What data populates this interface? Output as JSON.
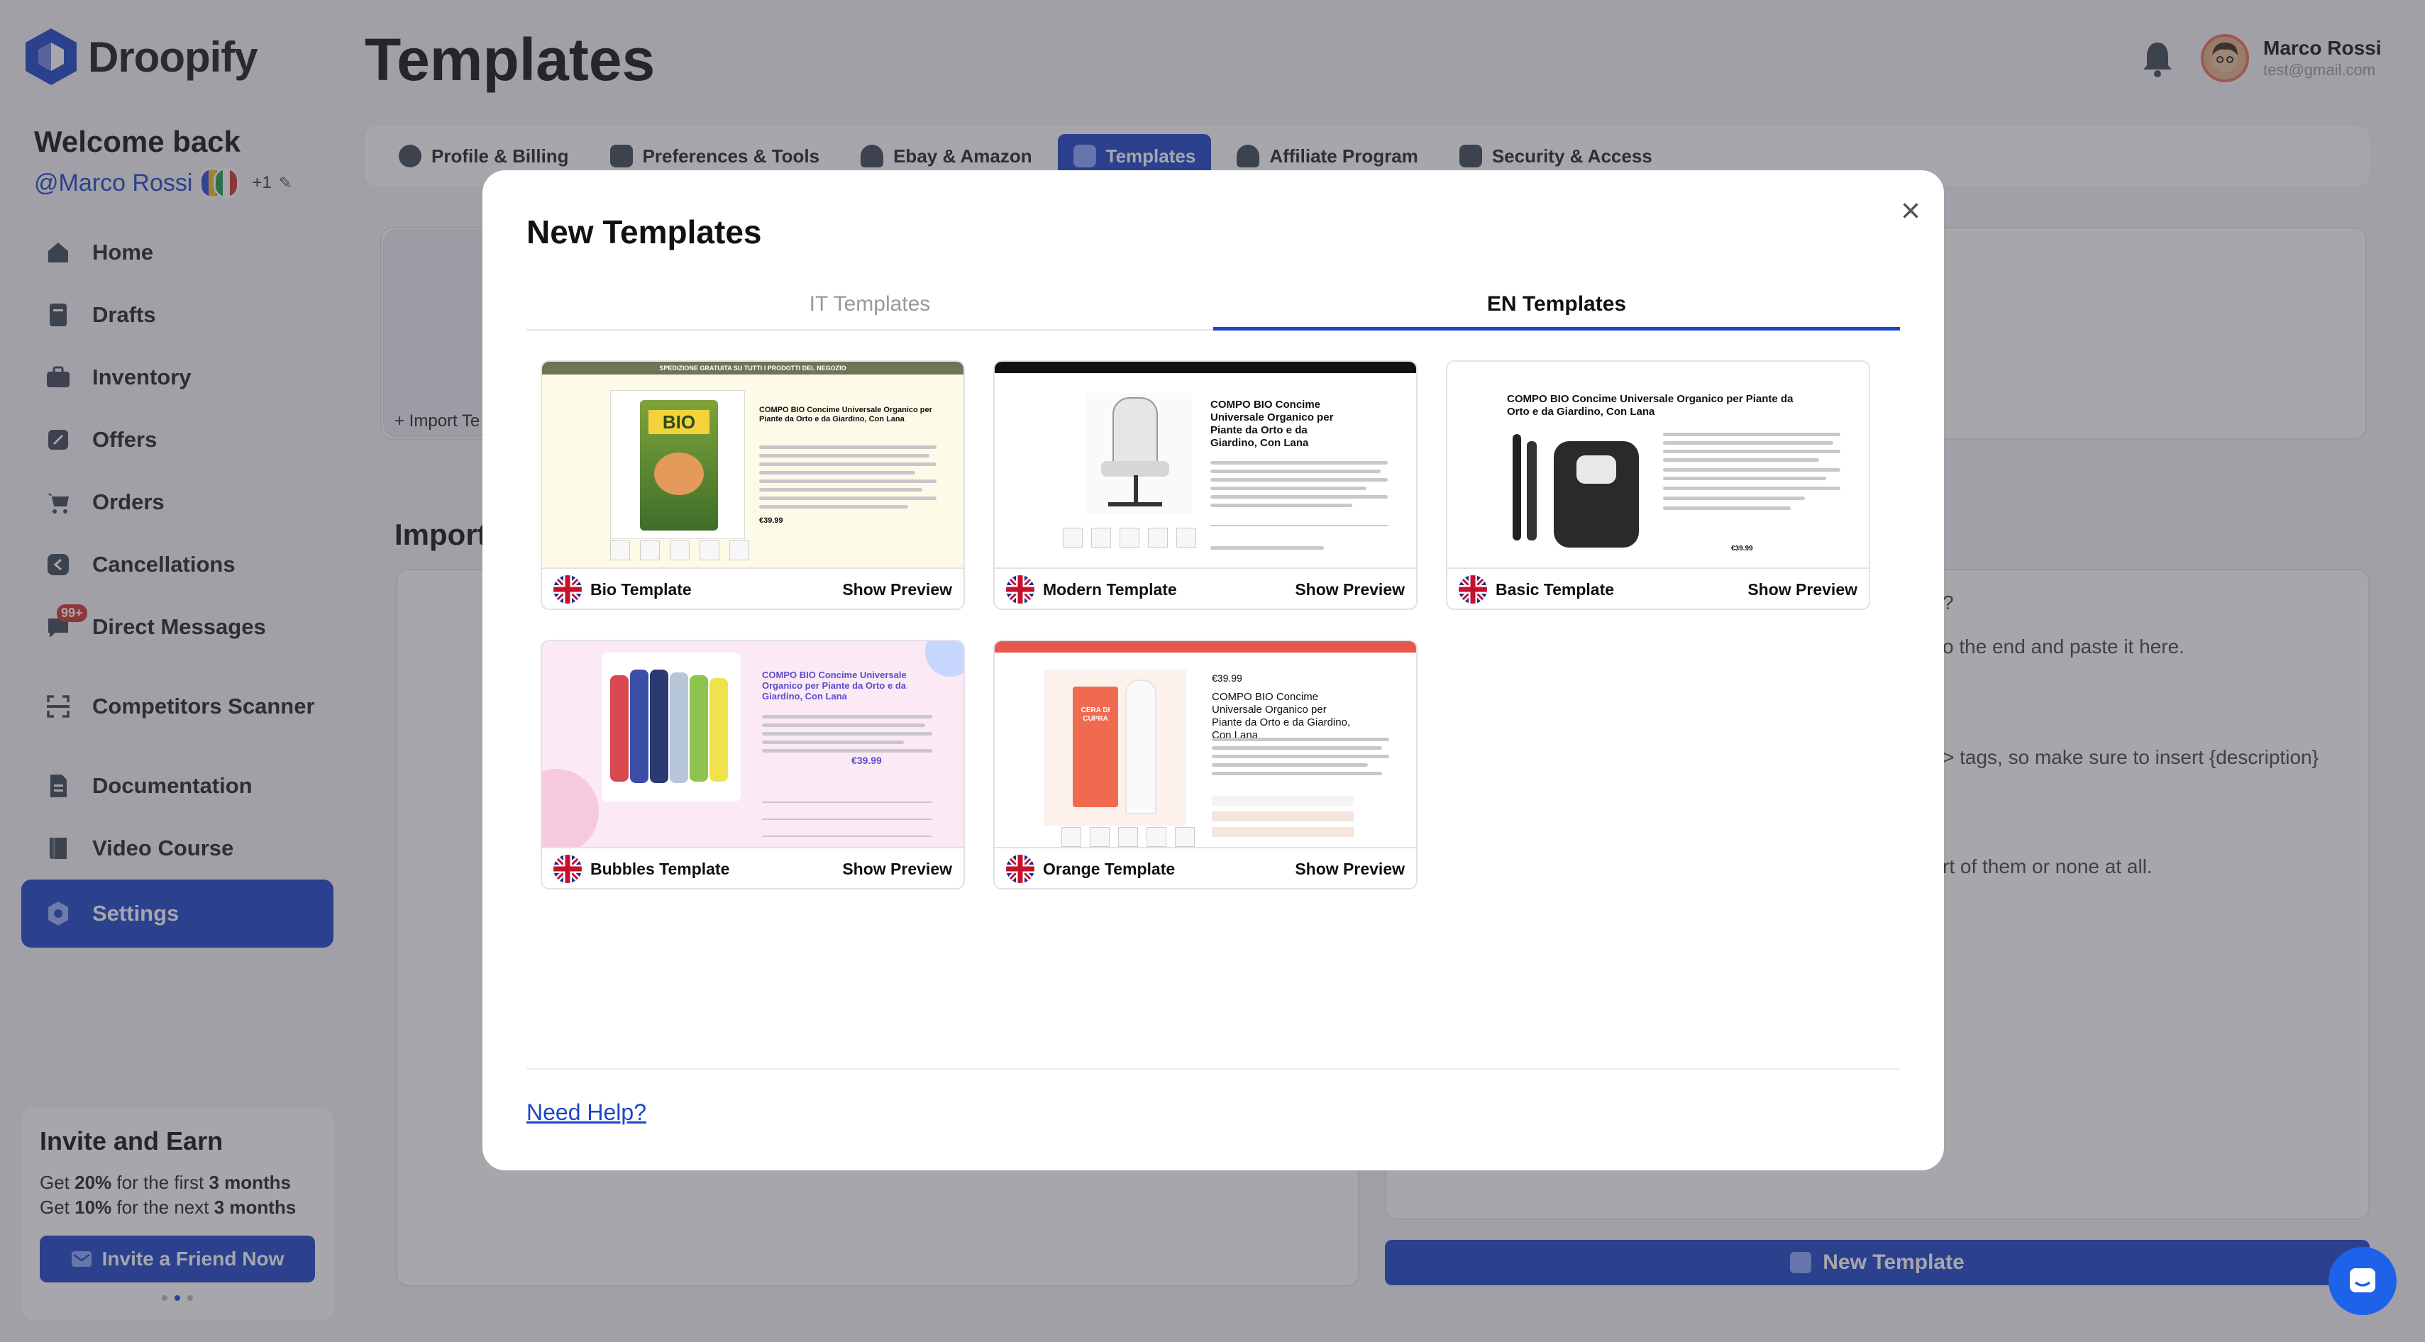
{
  "app": {
    "name": "Droopify",
    "page_title": "Templates"
  },
  "user": {
    "name": "Marco Rossi",
    "email": "test@gmail.com",
    "handle": "@Marco Rossi",
    "extra_accounts": "+1"
  },
  "welcome": {
    "title": "Welcome back"
  },
  "nav": {
    "items": [
      {
        "label": "Home",
        "icon": "home-icon"
      },
      {
        "label": "Drafts",
        "icon": "drafts-icon"
      },
      {
        "label": "Inventory",
        "icon": "inventory-icon"
      },
      {
        "label": "Offers",
        "icon": "offers-icon"
      },
      {
        "label": "Orders",
        "icon": "cart-icon"
      },
      {
        "label": "Cancellations",
        "icon": "cancel-icon"
      },
      {
        "label": "Direct Messages",
        "icon": "messages-icon",
        "badge": "99+"
      },
      {
        "label": "Competitors Scanner",
        "icon": "scanner-icon"
      },
      {
        "label": "Documentation",
        "icon": "document-icon"
      },
      {
        "label": "Video Course",
        "icon": "book-icon"
      },
      {
        "label": "Settings",
        "icon": "gear-icon",
        "active": true
      }
    ]
  },
  "invite": {
    "title": "Invite and Earn",
    "line1_pre": "Get ",
    "line1_pct": "20%",
    "line1_mid": " for the first ",
    "line1_dur": "3 months",
    "line2_pre": "Get ",
    "line2_pct": "10%",
    "line2_mid": " for the next ",
    "line2_dur": "3 months",
    "button": "Invite a Friend Now"
  },
  "settings_tabs": [
    {
      "label": "Profile & Billing"
    },
    {
      "label": "Preferences & Tools"
    },
    {
      "label": "Ebay & Amazon"
    },
    {
      "label": "Templates",
      "active": true
    },
    {
      "label": "Affiliate Program"
    },
    {
      "label": "Security & Access"
    }
  ],
  "background": {
    "import_link": "+ Import Te",
    "import_heading": "Import",
    "hint_q": "?",
    "hint1": "o the end and paste it here.",
    "hint2": "> tags, so make sure to insert {description}",
    "hint3": "rt of them or none at all.",
    "new_template_button": "New Template"
  },
  "modal": {
    "title": "New Templates",
    "tabs": [
      {
        "label": "IT Templates"
      },
      {
        "label": "EN Templates",
        "active": true
      }
    ],
    "templates": [
      {
        "name": "Bio Template",
        "action": "Show Preview"
      },
      {
        "name": "Modern Template",
        "action": "Show Preview"
      },
      {
        "name": "Basic Template",
        "action": "Show Preview"
      },
      {
        "name": "Bubbles Template",
        "action": "Show Preview"
      },
      {
        "name": "Orange Template",
        "action": "Show Preview"
      }
    ],
    "preview_title": "COMPO BIO Concime Universale Organico per Piante da Orto e da Giardino, Con Lana",
    "preview_price": "€39.99",
    "bio_banner": "SPEDIZIONE GRATUITA SU TUTTI I PRODOTTI DEL NEGOZIO",
    "bio_bag_label": "BIO",
    "orange_brand": "CERA DI CUPRA",
    "need_help": "Need Help?"
  },
  "colors": {
    "accent": "#1d45c8",
    "badge": "#d0322d",
    "overlay": "rgba(60,60,72,0.46)"
  }
}
